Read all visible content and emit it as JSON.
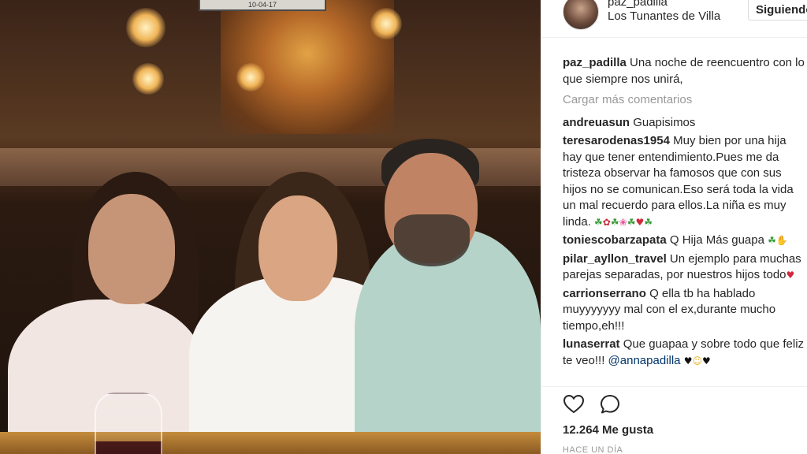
{
  "post": {
    "username": "paz_padilla",
    "location": "Los Tunantes de Villa",
    "follow_label": "Siguiendo",
    "photo_sign_text": "10-04-17"
  },
  "caption": {
    "username": "paz_padilla",
    "text": "Una noche de reencuentro con lo que siempre nos unirá,"
  },
  "load_more_label": "Cargar más comentarios",
  "comments": [
    {
      "username": "andreuasun",
      "text": "Guapisimos"
    },
    {
      "username": "teresarodenas1954",
      "text": "Muy bien por una hija hay que tener entendimiento.Pues me da tristeza observar ha famosos que con sus hijos no se comunican.Eso será toda la vida un mal recuerdo para ellos.La niña es muy linda."
    },
    {
      "username": "toniescobarzapata",
      "text": "Q Hija Más guapa"
    },
    {
      "username": "pilar_ayllon_travel",
      "text": "Un ejemplo para muchas parejas separadas, por nuestros hijos todo"
    },
    {
      "username": "carrionserrano",
      "text": "Q ella tb ha hablado muyyyyyyy mal con el ex,durante mucho tiempo,eh!!!"
    },
    {
      "username": "lunaserrat",
      "text": "Que guapaa y sobre todo que feliz te veo!!!",
      "mention": "@annapadilla"
    }
  ],
  "actions": {
    "like_icon": "heart-icon",
    "comment_icon": "comment-icon",
    "likes_text": "12.264 Me gusta",
    "time_text": "HACE UN DÍA"
  },
  "colors": {
    "text": "#262626",
    "muted": "#999999",
    "mention": "#003569",
    "border": "#efefef"
  }
}
